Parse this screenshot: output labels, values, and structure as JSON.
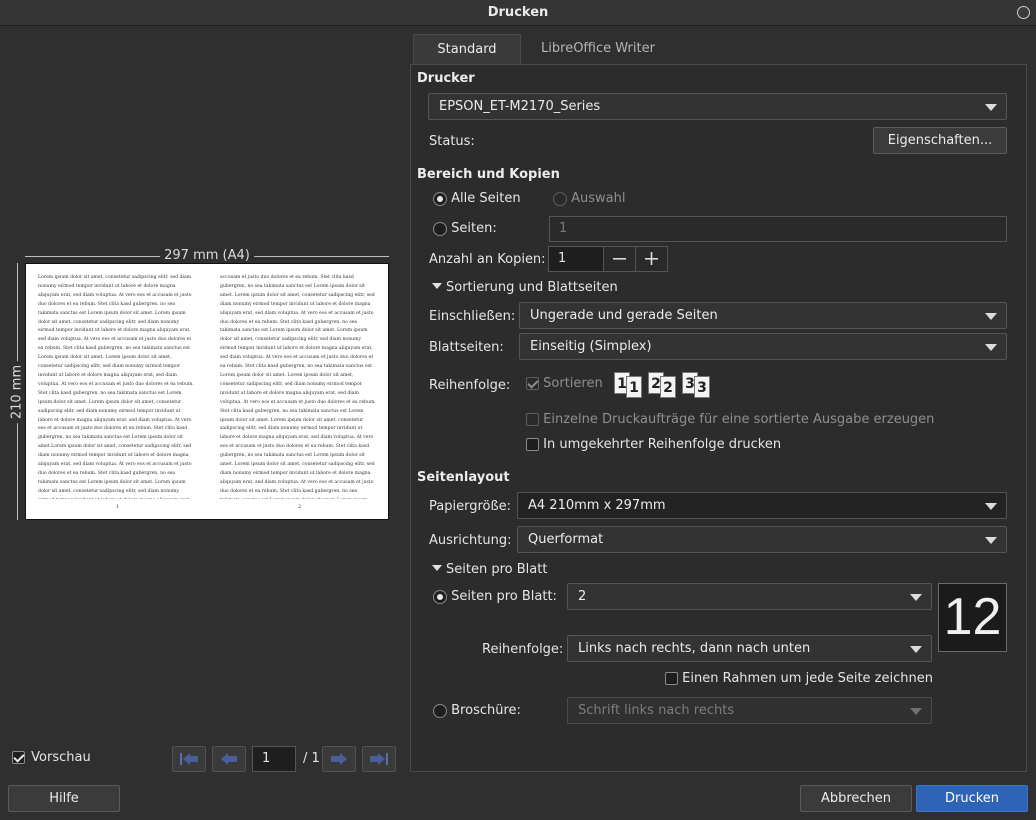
{
  "window": {
    "title": "Drucken"
  },
  "preview": {
    "width_label": "297 mm (A4)",
    "height_label": "210 mm",
    "column_text": "Lorem ipsum dolor sit amet, consetetur sadipscing elitr, sed diam nonumy eirmod tempor invidunt ut labore et dolore magna aliquyam erat, sed diam voluptua. At vero eos et accusam et justo duo dolores et ea rebum. Stet clita kasd gubergren, no sea takimata sanctus est Lorem ipsum dolor sit amet. Lorem ipsum dolor sit amet, consetetur sadipscing elitr, sed diam nonumy eirmod tempor invidunt ut labore et dolore magna aliquyam erat, sed diam voluptua. At vero eos et accusam et justo duo dolores et ea rebum. Stet clita kasd gubergren, no sea takimata sanctus est Lorem ipsum dolor sit amet. Lorem ipsum dolor sit amet, consetetur sadipscing elitr, sed diam nonumy eirmod tempor invidunt ut labore et dolore magna aliquyam erat, sed diam voluptua. At vero eos et accusam et justo duo dolores et ea rebum. Stet clita kasd gubergren, no sea takimata sanctus est Lorem ipsum dolor sit amet. Lorem ipsum dolor sit amet, consetetur sadipscing elitr, sed diam nonumy eirmod tempor invidunt ut labore et dolore magna aliquyam erat, sed diam voluptua. At vero eos et accusam et justo duo dolores et ea rebum. Stet clita kasd gubergren, no sea takimata sanctus est Lorem ipsum dolor sit amet.Lorem ipsum dolor sit amet, consetetur sadipscing elitr, sed diam nonumy eirmod tempor invidunt ut labore et dolore magna aliquyam erat, sed diam voluptua. At vero eos et accusam et justo duo dolores et ea rebum. Stet clita kasd gubergren, no sea takimata sanctus est Lorem ipsum dolor sit amet. Lorem ipsum dolor sit amet, consetetur sadipscing elitr, sed diam nonumy eirmod tempor invidunt ut labore et dolore magna aliquyam erat, sed diam voluptua. At vero eos et accusam et justo duo dolores et ea rebum. Stet clita kasd gubergren, no sea takimata sanctus est Lorem ipsum dolor sit amet.",
    "column_text_2": "accusam et justo duo dolores et ea rebum. Stet clita kasd gubergren, no sea takimata sanctus est Lorem ipsum dolor sit amet. Lorem ipsum dolor sit amet, consetetur sadipscing elitr, sed diam nonumy eirmod tempor invidunt ut labore et dolore magna aliquyam erat, sed diam voluptua. At vero eos et accusam et justo duo dolores et ea rebum. Stet clita kasd gubergren, no sea takimata sanctus est Lorem ipsum dolor sit amet. Lorem ipsum dolor sit amet, consetetur sadipscing elitr, sed diam nonumy eirmod tempor invidunt ut labore et dolore magna aliquyam erat, sed diam voluptua. At vero eos et accusam et justo duo dolores et ea rebum. Stet clita kasd gubergren, no sea takimata sanctus est Lorem ipsum dolor sit amet. Lorem ipsum dolor sit amet, consetetur sadipscing elitr, sed diam nonumy eirmod tempor invidunt ut labore et dolore magna aliquyam erat, sed diam voluptua. At vero eos et accusam et justo duo dolores et ea rebum. Stet clita kasd gubergren, no sea takimata sanctus est Lorem ipsum dolor sit amet. Lorem ipsum dolor sit amet, consetetur sadipscing elitr, sed diam nonumy eirmod tempor invidunt ut labore et dolore magna aliquyam erat, sed diam voluptua. At vero eos et accusam et justo duo dolores et ea rebum. Stet clita kasd gubergren, no sea takimata sanctus est Lorem ipsum dolor sit amet. Lorem ipsum dolor sit amet, consetetur sadipscing elitr, sed diam nonumy eirmod tempor invidunt ut labore et dolore magna aliquyam erat, sed diam voluptua. At vero eos et accusam et justo duo dolores et ea rebum. Stet clita kasd gubergren, no sea takimata sanctus est Lorem ipsum dolor sit amet. Lorem ipsum dolor sit amet, consetetur sadipscing elitr, sed diam nonumy eirmod tempor invidunt ut labore et dolore magna aliquyam erat, sed diam voluptua. At vero eos et",
    "page_num_1": "1",
    "page_num_2": "2",
    "show_preview_label": "Vorschau",
    "page_input_value": "1",
    "page_total": "/ 1"
  },
  "tabs": [
    "Standard",
    "LibreOffice Writer"
  ],
  "printer": {
    "section": "Drucker",
    "selected": "EPSON_ET-M2170_Series",
    "status_label": "Status:",
    "properties_button": "Eigenschaften..."
  },
  "range": {
    "section": "Bereich und Kopien",
    "all_pages": "Alle Seiten",
    "selection": "Auswahl",
    "pages_label": "Seiten:",
    "pages_value": "1",
    "copies_label": "Anzahl an Kopien:",
    "copies_value": "1"
  },
  "collation": {
    "expander": "Sortierung und Blattseiten",
    "include_label": "Einschließen:",
    "include_value": "Ungerade und gerade Seiten",
    "sides_label": "Blattseiten:",
    "sides_value": "Einseitig (Simplex)",
    "order_label": "Reihenfolge:",
    "collate_label": "Sortieren",
    "collate_digits": [
      "1",
      "1",
      "2",
      "2",
      "3",
      "3"
    ],
    "separate_jobs": "Einzelne Druckaufträge für eine sortierte Ausgabe erzeugen",
    "reverse_order": "In umgekehrter Reihenfolge drucken"
  },
  "layout": {
    "section": "Seitenlayout",
    "paper_label": "Papiergröße:",
    "paper_value": "A4 210mm x 297mm",
    "orientation_label": "Ausrichtung:",
    "orientation_value": "Querformat",
    "pps_expander": "Seiten pro Blatt",
    "pps_label": "Seiten pro Blatt:",
    "pps_value": "2",
    "pps_preview": "12",
    "order_label": "Reihenfolge:",
    "order_value": "Links nach rechts, dann nach unten",
    "border_label": "Einen Rahmen um jede Seite zeichnen",
    "brochure_label": "Broschüre:",
    "brochure_value": "Schrift links nach rechts"
  },
  "buttons": {
    "help": "Hilfe",
    "cancel": "Abbrechen",
    "print": "Drucken"
  },
  "colors": {
    "accent": "#2f63b5",
    "nav_arrow": "#4a5f9a"
  }
}
